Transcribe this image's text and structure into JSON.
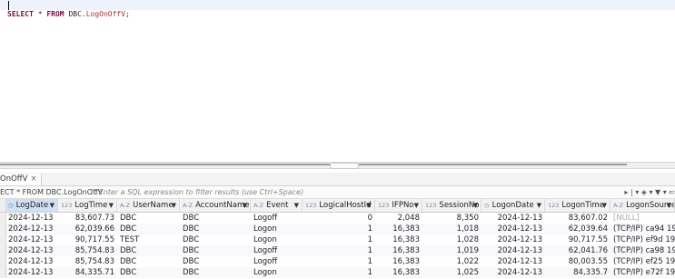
{
  "editor": {
    "sql_select": "SELECT",
    "sql_star": " * ",
    "sql_from": "FROM",
    "sql_object": " DBC.",
    "sql_view": "LogOnOffV",
    "sql_end": ";"
  },
  "tab": {
    "label": "OnOffV",
    "close": "×"
  },
  "filter": {
    "query": "ECT * FROM DBC.LogOnOffV",
    "icon": "⛶",
    "placeholder": "Enter a SQL expression to filter results (use Ctrl+Space)",
    "tools": "▸ | ▾  ◈ ▾  ▼ ▾  ⇐"
  },
  "columns": [
    {
      "name": "LogDate",
      "type_icon": "◷"
    },
    {
      "name": "LogTime",
      "type_icon": "123"
    },
    {
      "name": "UserName",
      "type_icon": "A-Z"
    },
    {
      "name": "AccountName",
      "type_icon": "A-Z"
    },
    {
      "name": "Event",
      "type_icon": "A-Z"
    },
    {
      "name": "LogicalHostId",
      "type_icon": "123"
    },
    {
      "name": "IFPNo",
      "type_icon": "123"
    },
    {
      "name": "SessionNo",
      "type_icon": "123"
    },
    {
      "name": "LogonDate",
      "type_icon": "◷"
    },
    {
      "name": "LogonTime",
      "type_icon": "123"
    },
    {
      "name": "LogonSource",
      "type_icon": "A-Z"
    }
  ],
  "rows": [
    [
      "2024-12-13",
      "83,607.73",
      "DBC",
      "DBC",
      "Logoff",
      "0",
      "2,048",
      "8,350",
      "2024-12-13",
      "83,607.02",
      "[NULL]"
    ],
    [
      "2024-12-13",
      "62,039.66",
      "DBC",
      "DBC",
      "Logon",
      "1",
      "16,383",
      "1,018",
      "2024-12-13",
      "62,039.64",
      "(TCP/IP) ca94 192.1"
    ],
    [
      "2024-12-13",
      "90,717.55",
      "TEST",
      "DBC",
      "Logon",
      "1",
      "16,383",
      "1,028",
      "2024-12-13",
      "90,717.55",
      "(TCP/IP) ef9d 192.1"
    ],
    [
      "2024-12-13",
      "85,754.83",
      "DBC",
      "DBC",
      "Logoff",
      "1",
      "16,383",
      "1,019",
      "2024-12-13",
      "62,041.76",
      "(TCP/IP) ca98 192.1"
    ],
    [
      "2024-12-13",
      "85,754.83",
      "DBC",
      "DBC",
      "Logoff",
      "1",
      "16,383",
      "1,022",
      "2024-12-13",
      "80,003.55",
      "(TCP/IP) ef25 192.1"
    ],
    [
      "2024-12-13",
      "84,335.71",
      "DBC",
      "DBC",
      "Logon",
      "1",
      "16,383",
      "1,025",
      "2024-12-13",
      "84,335.7",
      "(TCP/IP) e72f 192.1"
    ]
  ]
}
